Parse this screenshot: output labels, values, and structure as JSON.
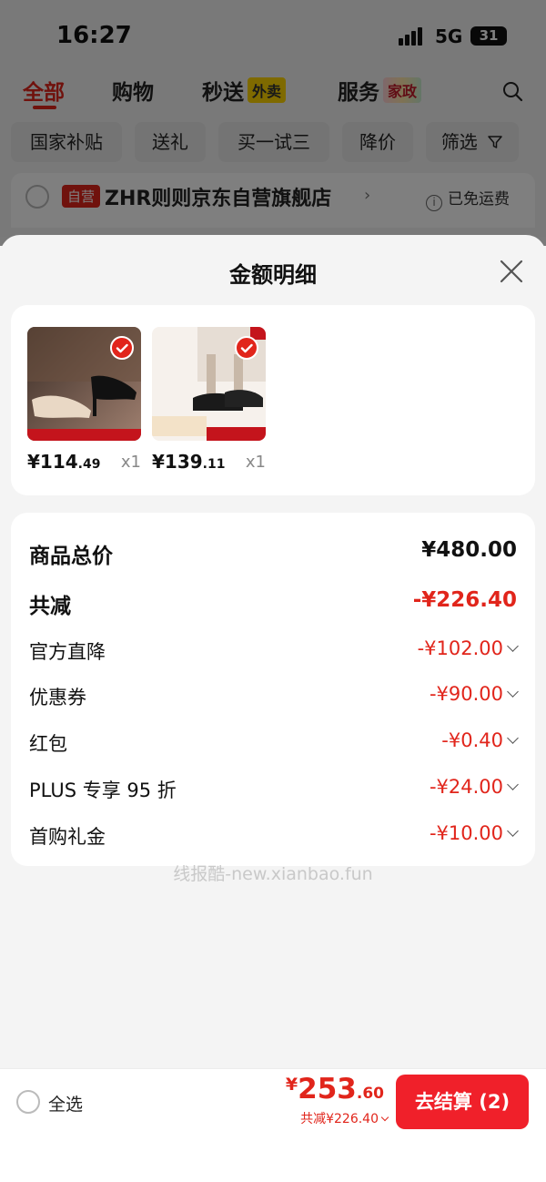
{
  "status_bar": {
    "time": "16:27",
    "network": "5G",
    "battery": "31"
  },
  "categories": {
    "tabs": [
      {
        "label": "全部",
        "badge": ""
      },
      {
        "label": "购物",
        "badge": ""
      },
      {
        "label": "秒送",
        "badge": "外卖"
      },
      {
        "label": "服务",
        "badge": "家政"
      }
    ],
    "active": "全部"
  },
  "filters": [
    "国家补贴",
    "送礼",
    "买一试三",
    "降价",
    "筛选"
  ],
  "store": {
    "tag": "自营",
    "name": "ZHR则则京东自营旗舰店",
    "shipping": "已免运费"
  },
  "sheet": {
    "title": "金额明细",
    "products": [
      {
        "price_int": "¥114",
        "price_dec": ".49",
        "qty": "x1"
      },
      {
        "price_int": "¥139",
        "price_dec": ".11",
        "qty": "x1"
      }
    ],
    "summary": {
      "total_label": "商品总价",
      "total_value": "¥480.00",
      "reduce_label": "共减",
      "reduce_value": "-¥226.40"
    },
    "discounts": [
      {
        "label": "官方直降",
        "value": "-¥102.00"
      },
      {
        "label": "优惠券",
        "value": "-¥90.00"
      },
      {
        "label": "红包",
        "value": "-¥0.40"
      },
      {
        "label": "PLUS 专享 95 折",
        "value": "-¥24.00"
      },
      {
        "label": "首购礼金",
        "value": "-¥10.00"
      }
    ],
    "watermark": "线报酷-new.xianbao.fun"
  },
  "bottom": {
    "select_all": "全选",
    "yen": "¥",
    "total_int": "253",
    "total_dec": ".60",
    "reduce_text": "共减¥226.40",
    "checkout": "去结算 (2)"
  },
  "colors": {
    "accent": "#e1251b",
    "checkout": "#f0202a"
  }
}
